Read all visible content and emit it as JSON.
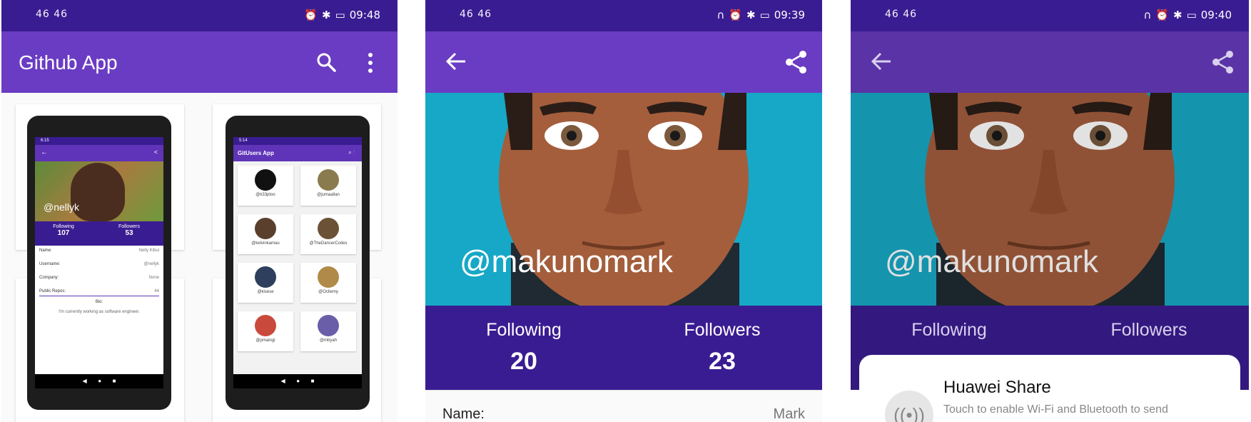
{
  "panel1": {
    "status": {
      "signal": "46 46",
      "time": "09:48"
    },
    "app_title": "Github App",
    "left_device": {
      "time": "6:15",
      "handle": "@nellyk",
      "following_label": "Following",
      "following_value": "107",
      "followers_label": "Followers",
      "followers_value": "53",
      "rows": [
        {
          "label": "Name:",
          "value": "Nelly Kibui"
        },
        {
          "label": "Username:",
          "value": "@nellyk"
        },
        {
          "label": "Company:",
          "value": "None"
        },
        {
          "label": "Public Repos:",
          "value": "44"
        }
      ],
      "bio_label": "Bio:",
      "bio_text": "I'm currently working as  software engineer."
    },
    "right_device": {
      "time": "5:14",
      "title": "GitUsers App",
      "users": [
        "@k33ptoo",
        "@jumaallan",
        "@kelvinkamau",
        "@TheDancerCodes",
        "@kisese",
        "@Ocliemy",
        "@pmaingi",
        "@mbyah"
      ]
    }
  },
  "panel2": {
    "status": {
      "signal": "46 46",
      "time": "09:39"
    },
    "handle": "@makunomark",
    "following_label": "Following",
    "following_value": "20",
    "followers_label": "Followers",
    "followers_value": "23",
    "name_label": "Name:",
    "name_value": "Mark"
  },
  "panel3": {
    "status": {
      "signal": "46 46",
      "time": "09:40"
    },
    "handle": "@makunomark",
    "following_label": "Following",
    "followers_label": "Followers",
    "share_title": "Huawei Share",
    "share_desc": "Touch to enable Wi-Fi and Bluetooth to send"
  },
  "colors": {
    "statusbar": "#3a1c92",
    "appbar": "#6a3cc3",
    "hero": "#1ba7c4",
    "stats": "#3a1c92"
  }
}
